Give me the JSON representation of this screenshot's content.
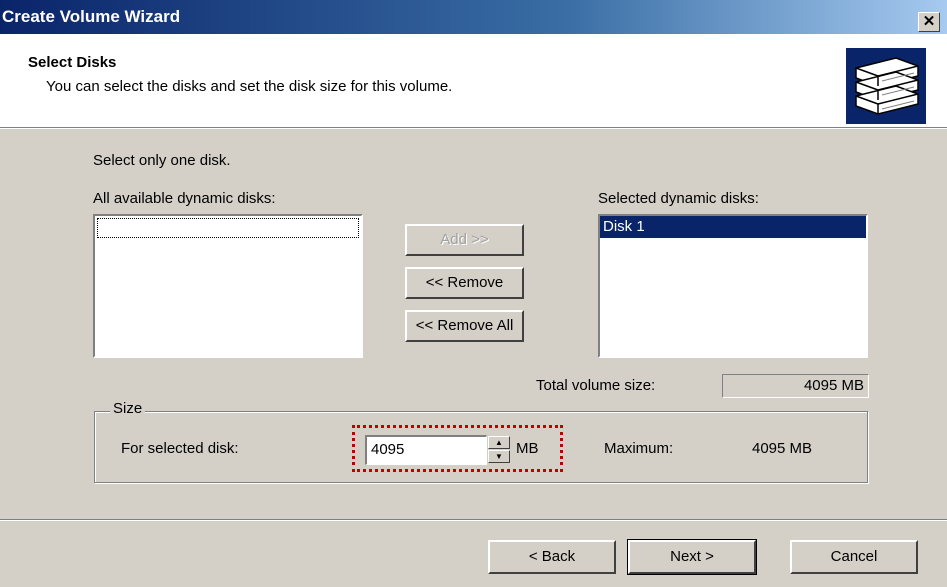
{
  "window": {
    "title": "Create Volume Wizard",
    "close_glyph": "✕"
  },
  "header": {
    "title": "Select Disks",
    "subtitle": "You can select the disks and set the disk size for this volume.",
    "icon": "disk-stack-icon"
  },
  "content": {
    "instruction": "Select only one disk.",
    "available_label": "All available dynamic disks:",
    "available_disks": [],
    "selected_label": "Selected dynamic disks:",
    "selected_disks": [
      "Disk 1"
    ],
    "buttons": {
      "add": "Add >>",
      "remove": "<< Remove",
      "remove_all": "<< Remove All"
    },
    "total_label": "Total volume size:",
    "total_value": "4095 MB"
  },
  "size_group": {
    "legend": "Size",
    "for_selected_label": "For selected disk:",
    "value": "4095",
    "unit": "MB",
    "maximum_label": "Maximum:",
    "maximum_value": "4095 MB"
  },
  "footer": {
    "back": "< Back",
    "next": "Next >",
    "cancel": "Cancel"
  },
  "colors": {
    "titlebar": "#0a246a",
    "selection": "#0a246a",
    "highlight": "#c00000",
    "face": "#d4d0c8"
  }
}
